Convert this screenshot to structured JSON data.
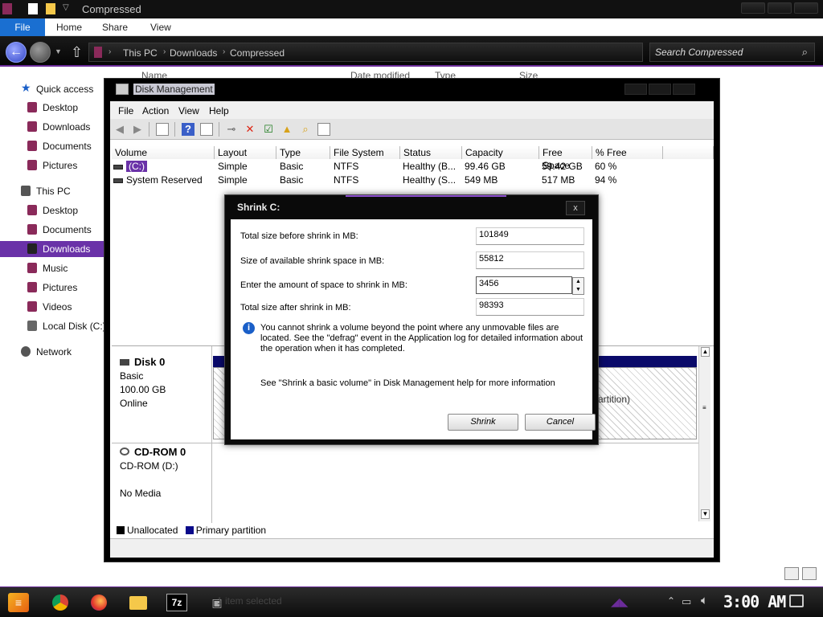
{
  "explorer": {
    "title": "Compressed",
    "ribbon_tabs": [
      "File",
      "Home",
      "Share",
      "View"
    ],
    "breadcrumb": [
      "This PC",
      "Downloads",
      "Compressed"
    ],
    "search_placeholder": "Search Compressed",
    "column_headers": [
      "Name",
      "Date modified",
      "Type",
      "Size"
    ],
    "nav": {
      "quick_access": "Quick access",
      "quick_items": [
        "Desktop",
        "Downloads",
        "Documents",
        "Pictures"
      ],
      "this_pc": "This PC",
      "pc_items": [
        "Desktop",
        "Documents",
        "Downloads",
        "Music",
        "Pictures",
        "Videos",
        "Local Disk (C:)"
      ],
      "network": "Network",
      "selected": "Downloads"
    }
  },
  "disk_management": {
    "title": "Disk Management",
    "menu": [
      "File",
      "Action",
      "View",
      "Help"
    ],
    "columns": [
      "Volume",
      "Layout",
      "Type",
      "File System",
      "Status",
      "Capacity",
      "Free Space",
      "% Free"
    ],
    "volumes": [
      {
        "volume": "(C:)",
        "layout": "Simple",
        "type": "Basic",
        "fs": "NTFS",
        "status": "Healthy (B...",
        "capacity": "99.46 GB",
        "free": "59.42 GB",
        "pct": "60 %"
      },
      {
        "volume": "System Reserved",
        "layout": "Simple",
        "type": "Basic",
        "fs": "NTFS",
        "status": "Healthy (S...",
        "capacity": "549 MB",
        "free": "517 MB",
        "pct": "94 %"
      }
    ],
    "disk0": {
      "name": "Disk 0",
      "type": "Basic",
      "size": "100.00 GB",
      "state": "Online",
      "partition_text": "artition)"
    },
    "cdrom": {
      "name": "CD-ROM 0",
      "drive": "CD-ROM (D:)",
      "media": "No Media"
    },
    "legend": {
      "unallocated": "Unallocated",
      "primary": "Primary partition",
      "unallocated_color": "#000000",
      "primary_color": "#0a0a8a"
    }
  },
  "dialog": {
    "title": "Shrink C:",
    "rows": [
      {
        "label": "Total size before shrink in MB:",
        "value": "101849"
      },
      {
        "label": "Size of available shrink space in MB:",
        "value": "55812"
      },
      {
        "label": "Enter the amount of space to shrink in MB:",
        "value": "3456"
      },
      {
        "label": "Total size after shrink in MB:",
        "value": "98393"
      }
    ],
    "info": "You cannot shrink a volume beyond the point where any unmovable files are located. See the \"defrag\" event in the Application log for detailed information about the operation when it has completed.",
    "help": "See \"Shrink a basic volume\" in Disk Management help for more information",
    "shrink_label": "Shrink",
    "cancel_label": "Cancel",
    "close_glyph": "x"
  },
  "taskbar": {
    "seven_zip": "7z",
    "ghost_text": "1 item selected",
    "clock": "3:00 AM"
  }
}
